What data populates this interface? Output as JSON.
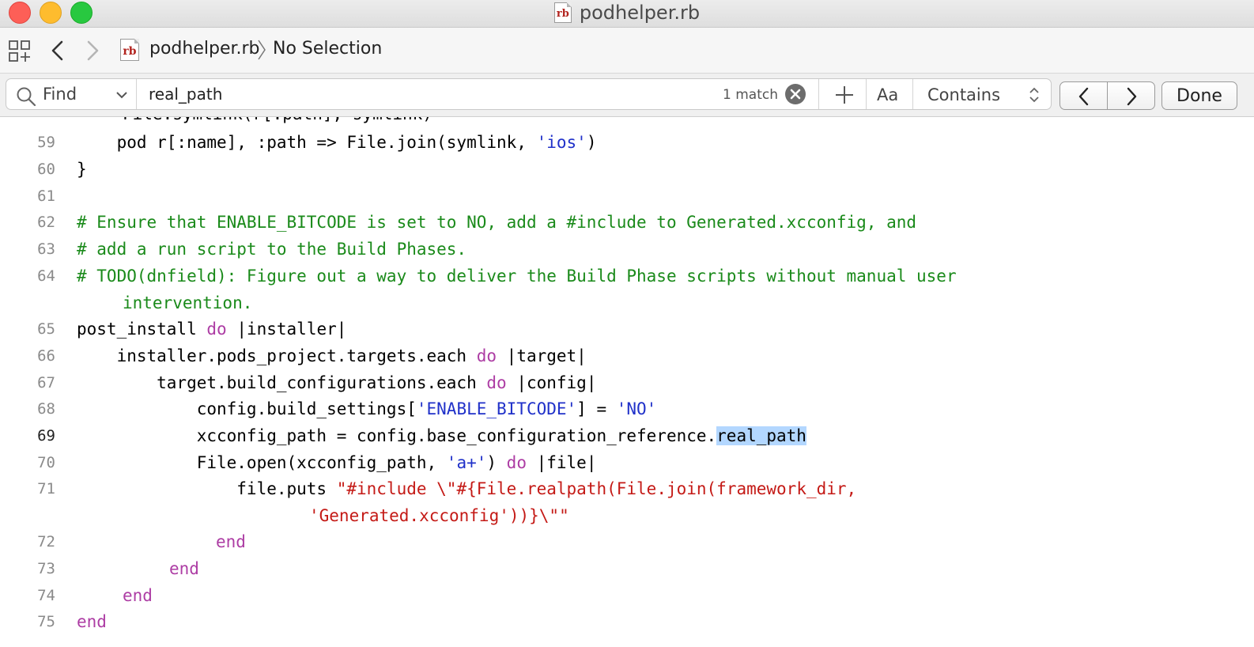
{
  "window": {
    "title": "podhelper.rb",
    "file_badge": "rb"
  },
  "jumpbar": {
    "file_name": "podhelper.rb",
    "selection": "No Selection"
  },
  "find": {
    "mode_label": "Find",
    "query": "real_path",
    "match_count": "1 match",
    "case_label": "Aa",
    "match_type": "Contains",
    "done_label": "Done"
  },
  "editor": {
    "current_line": "69",
    "top_partial_text": "File.symlink(r[:path], symlink)",
    "lines": [
      {
        "num": "59",
        "a": "    pod r[:name], :path => File.join(symlink, ",
        "b": "'ios'",
        "c": ")"
      },
      {
        "num": "60",
        "a": "}"
      },
      {
        "num": "61"
      },
      {
        "num": "62",
        "comment": "# Ensure that ENABLE_BITCODE is set to NO, add a #include to Generated.xcconfig, and"
      },
      {
        "num": "63",
        "comment": "# add a run script to the Build Phases."
      },
      {
        "num": "64",
        "comment": "# TODO(dnfield): Figure out a way to deliver the Build Phase scripts without manual user",
        "comment_cont": "intervention."
      },
      {
        "num": "65",
        "a": "post_install ",
        "kw": "do",
        "b": " |installer|"
      },
      {
        "num": "66",
        "a": "    installer.pods_project.targets.each ",
        "kw": "do",
        "b": " |target|"
      },
      {
        "num": "67",
        "a": "        target.build_configurations.each ",
        "kw": "do",
        "b": " |config|"
      },
      {
        "num": "68",
        "a": "            config.build_settings[",
        "s1": "'ENABLE_BITCODE'",
        "b": "] = ",
        "s2": "'NO'"
      },
      {
        "num": "69",
        "a": "            xcconfig_path = config.base_configuration_reference.",
        "hl": "real_path"
      },
      {
        "num": "70",
        "a": "            File.open(xcconfig_path, ",
        "s1": "'a+'",
        "b": ") ",
        "kw": "do",
        "c": " |file|"
      },
      {
        "num": "71",
        "a": "                file.puts ",
        "str": "\"#include \\\"#{File.realpath(File.join(framework_dir,",
        "str_cont": "'Generated.xcconfig'))}\\\"\""
      },
      {
        "num": "72",
        "kw": "end"
      },
      {
        "num": "73",
        "kw": "end"
      },
      {
        "num": "74",
        "kw": "end"
      },
      {
        "num": "75",
        "kw": "end"
      }
    ]
  }
}
